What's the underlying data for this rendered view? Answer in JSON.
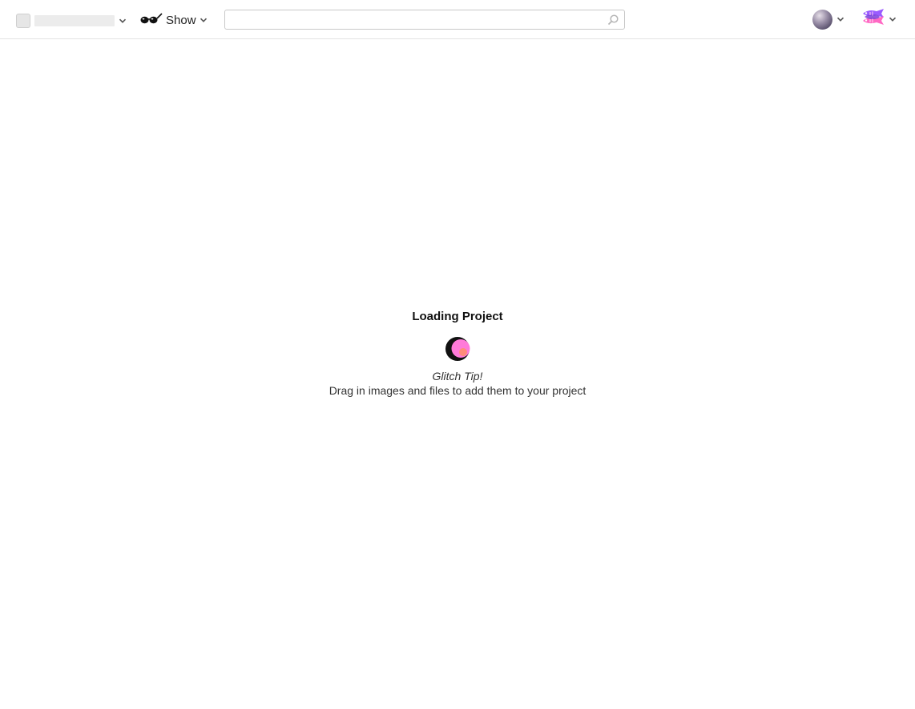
{
  "header": {
    "project_name": "",
    "show_label": "Show",
    "search": {
      "value": "",
      "placeholder": ""
    }
  },
  "icons": {
    "project": "project-avatar-icon",
    "show": "sunglasses-icon",
    "search": "search-icon",
    "user": "user-avatar",
    "glitch": "glitch-fish-logo",
    "loader": "loading-moon-icon"
  },
  "loading": {
    "title": "Loading Project",
    "tip_title": "Glitch Tip!",
    "tip_text": "Drag in images and files to add them to your project"
  },
  "colors": {
    "loader_dark": "#111111",
    "loader_pink": "#ff7ad9",
    "loader_coral": "#ff8c7a",
    "logo_purple": "#9a5cff",
    "logo_pink": "#ff69c4"
  }
}
